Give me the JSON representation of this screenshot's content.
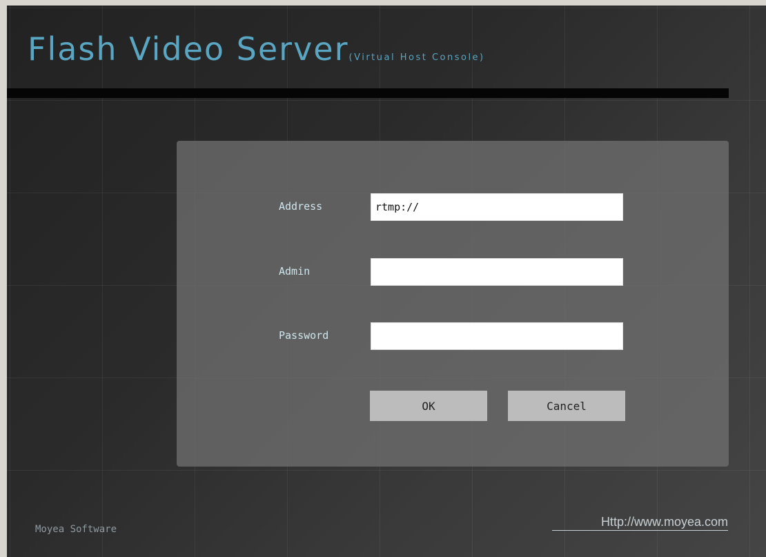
{
  "header": {
    "title": "Flash Video Server",
    "subtitle": "(Virtual Host Console)"
  },
  "login_form": {
    "address": {
      "label": "Address",
      "value": "rtmp://"
    },
    "admin": {
      "label": "Admin",
      "value": ""
    },
    "password": {
      "label": "Password",
      "value": ""
    },
    "ok_label": "OK",
    "cancel_label": "Cancel"
  },
  "footer": {
    "company": "Moyea Software",
    "website": "Http://www.moyea.com"
  },
  "colors": {
    "title": "#5aa6c2",
    "background": "#2b2b2b",
    "dialog": "#6e6e6e",
    "button": "#bcbcbc"
  }
}
